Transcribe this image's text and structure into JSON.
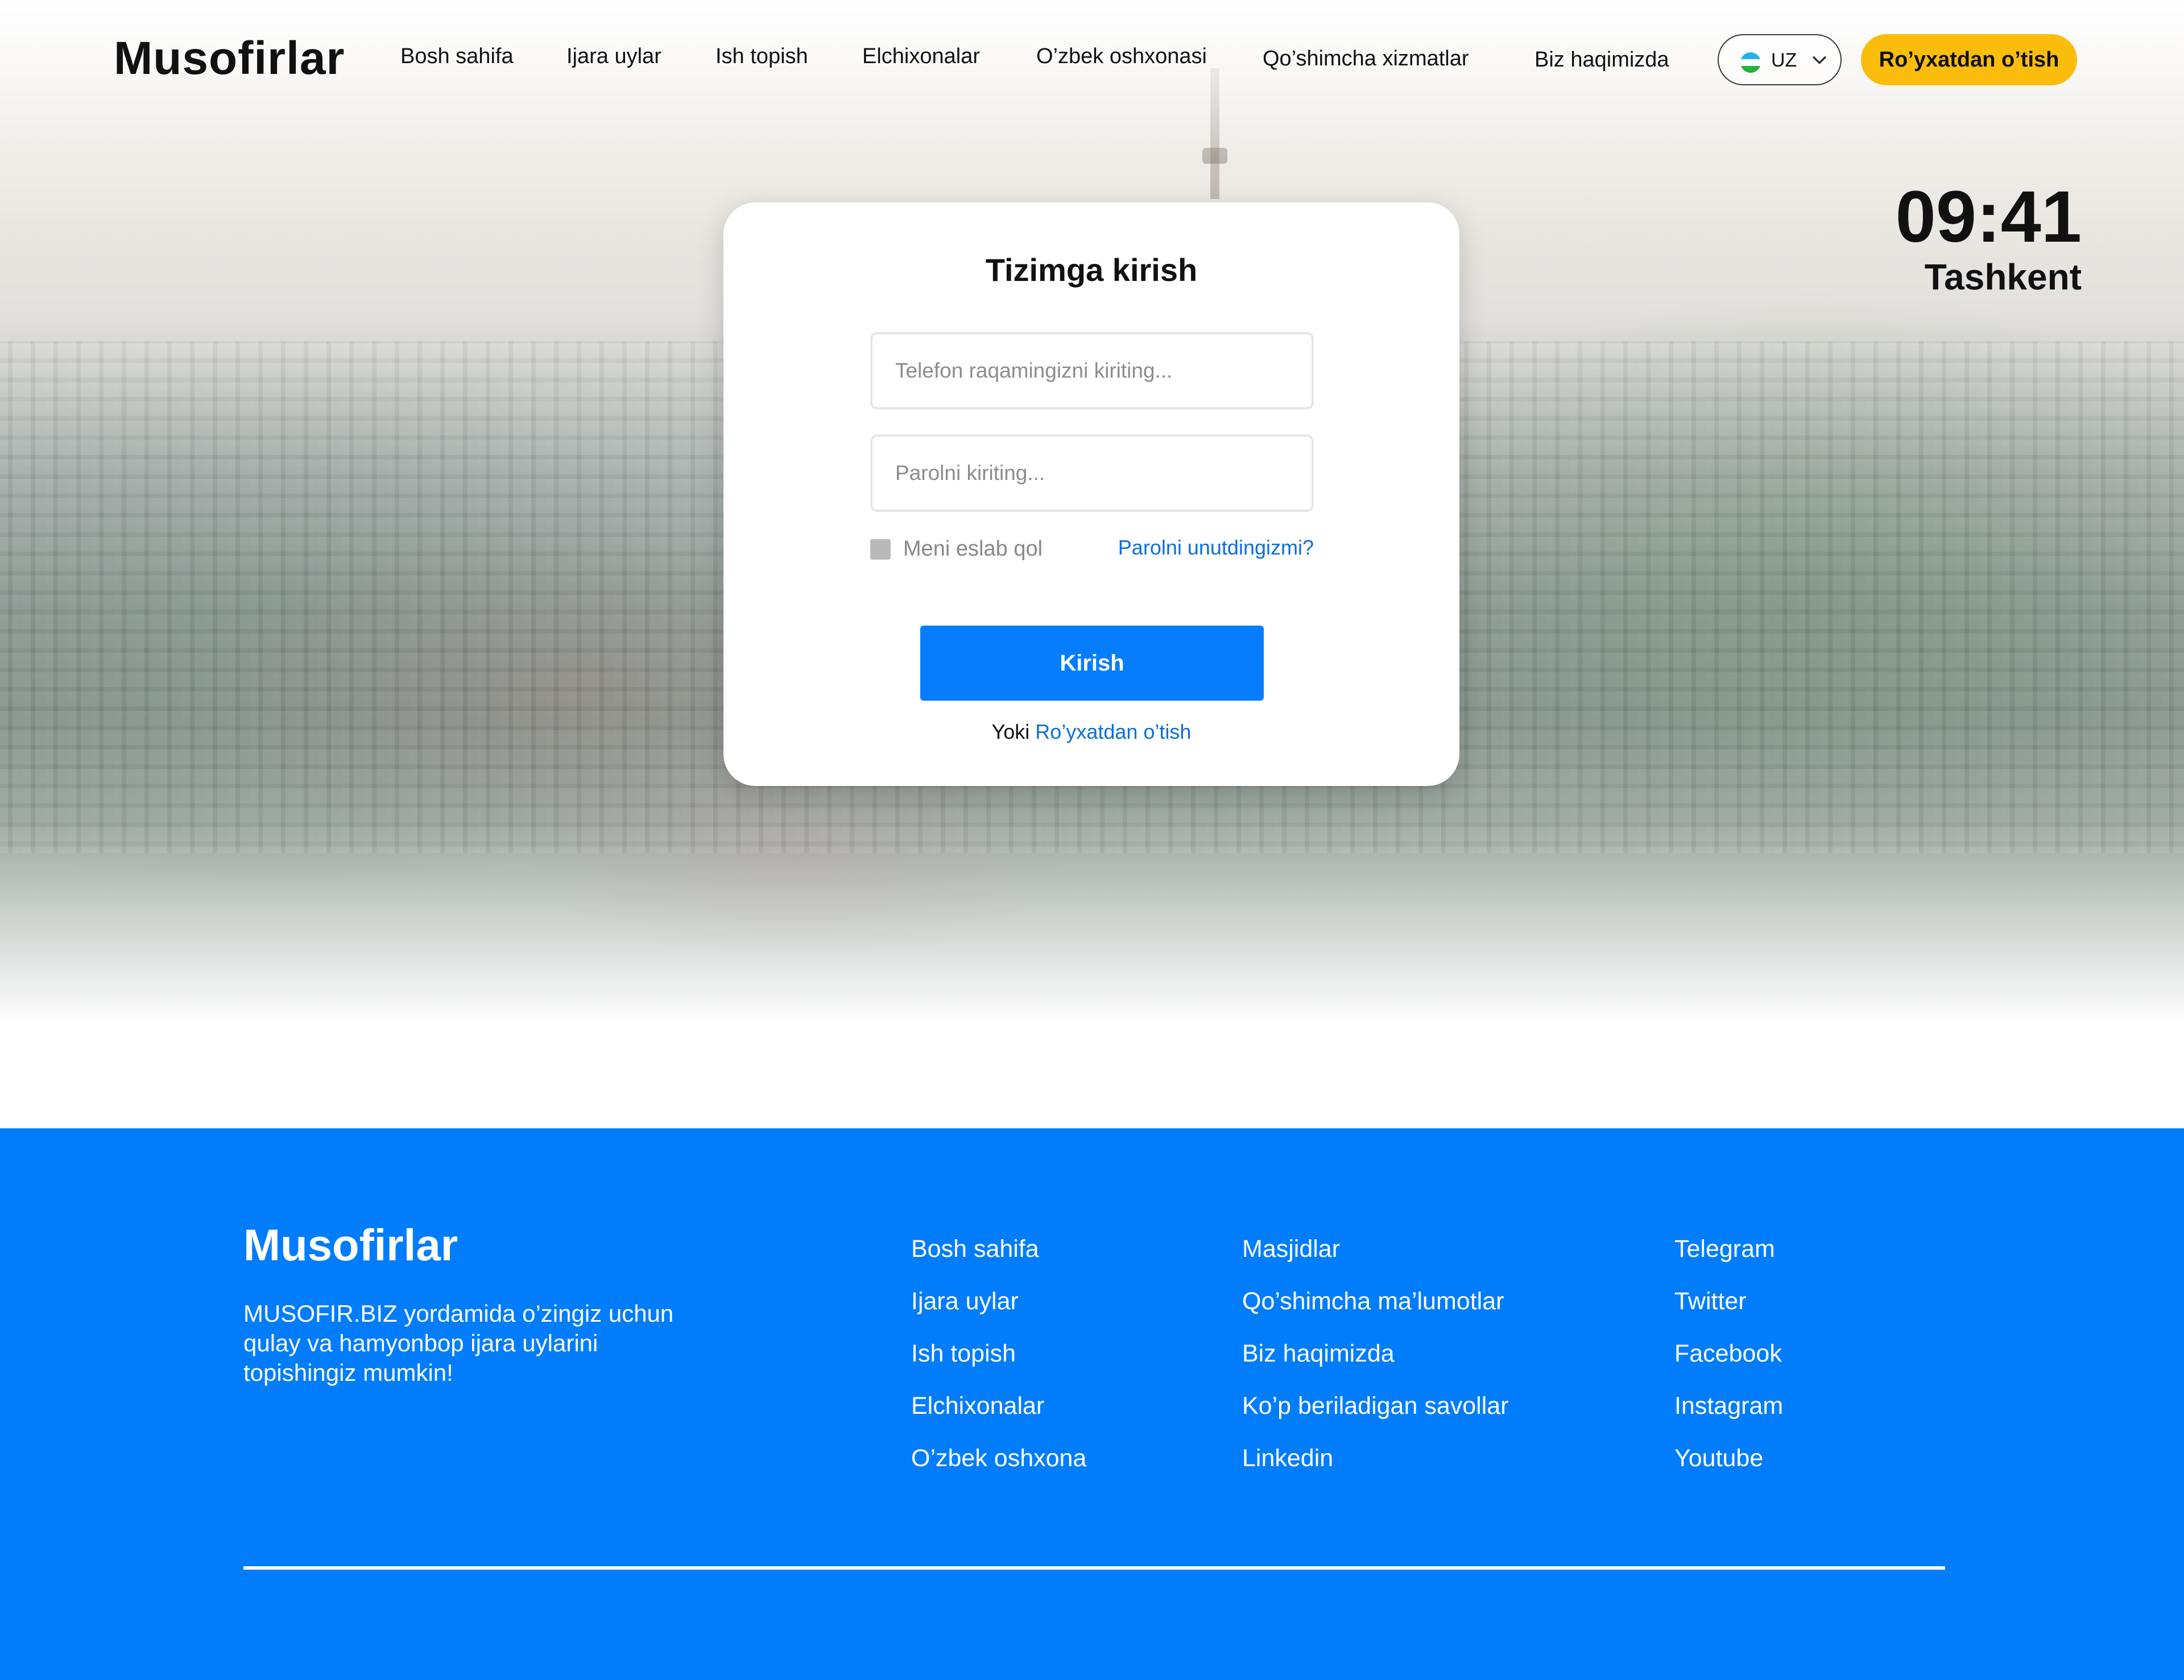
{
  "header": {
    "logo": "Musofirlar",
    "nav": [
      "Bosh sahifa",
      "Ijara uylar",
      "Ish topish",
      "Elchixonalar",
      "O’zbek oshxonasi",
      "Qo’shimcha xizmatlar",
      "Biz haqimizda"
    ],
    "language": {
      "code": "UZ",
      "flag_icon": "uzbekistan-flag-icon"
    },
    "register_label": "Ro’yxatdan o’tish"
  },
  "clock": {
    "time": "09:41",
    "city": "Tashkent"
  },
  "login": {
    "title": "Tizimga kirish",
    "phone_placeholder": "Telefon raqamingizni kiriting...",
    "phone_value": "",
    "password_placeholder": "Parolni kiriting...",
    "password_value": "",
    "remember_label": "Meni eslab qol",
    "remember_checked": false,
    "forgot_label": "Parolni unutdingizmi?",
    "submit_label": "Kirish",
    "alt_prefix": "Yoki",
    "alt_link": "Ro’yxatdan o’tish"
  },
  "footer": {
    "logo": "Musofirlar",
    "description": "MUSOFIR.BIZ yordamida o’zingiz uchun qulay va hamyonbop ijara uylarini topishingiz mumkin!",
    "col1": [
      "Bosh sahifa",
      "Ijara uylar",
      "Ish topish",
      "Elchixonalar",
      "O’zbek oshxona"
    ],
    "col2": [
      "Masjidlar",
      "Qo’shimcha ma’lumotlar",
      "Biz haqimizda",
      "Ko’p beriladigan savollar",
      "Linkedin"
    ],
    "col3": [
      "Telegram",
      "Twitter",
      "Facebook",
      "Instagram",
      "Youtube"
    ]
  },
  "colors": {
    "primary": "#017dfc",
    "accent": "#fbbd0c",
    "link": "#0a6fd8",
    "text": "#111111"
  }
}
